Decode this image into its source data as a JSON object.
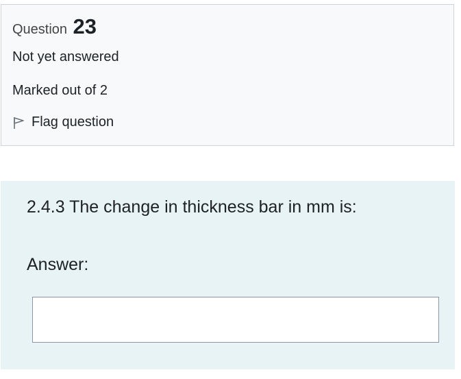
{
  "info": {
    "question_word": "Question",
    "question_number": "23",
    "state": "Not yet answered",
    "grade": "Marked out of 2",
    "flag_label": "Flag question",
    "flag_icon": "flag-outline-icon"
  },
  "content": {
    "question_text": "2.4.3 The change in thickness bar in mm is:",
    "answer_label": "Answer:",
    "answer_value": "",
    "answer_placeholder": ""
  },
  "colors": {
    "info_background": "#f8f9fa",
    "info_border": "#cfd4da",
    "content_background": "#e7f3f5",
    "text": "#1d2125"
  }
}
